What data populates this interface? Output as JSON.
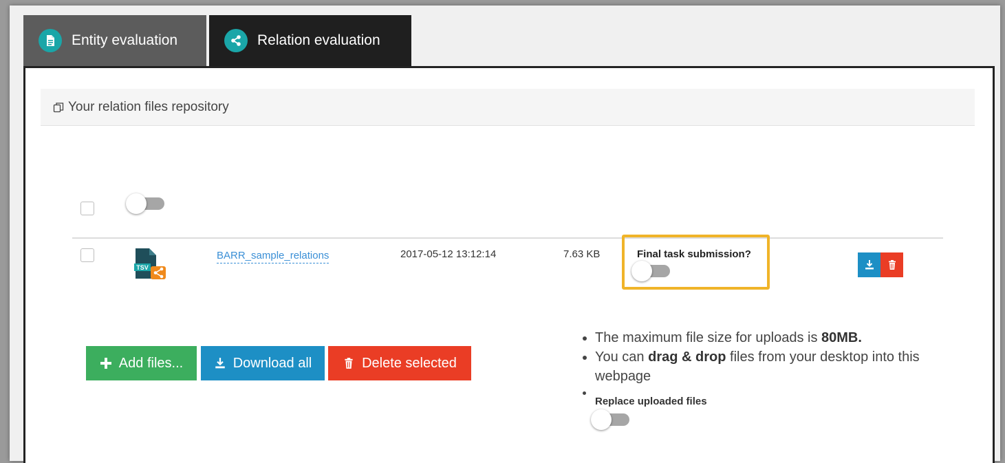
{
  "tabs": {
    "entity": {
      "label": "Entity evaluation",
      "icon": "document-icon"
    },
    "relation": {
      "label": "Relation evaluation",
      "icon": "share-icon",
      "active": true
    }
  },
  "repository": {
    "title": "Your relation files repository",
    "icon": "copy-icon"
  },
  "file_row": {
    "name": "BARR_sample_relations",
    "date": "2017-05-12 13:12:14",
    "size": "7.63 KB",
    "file_type": "TSV",
    "final_submission_label": "Final task submission?"
  },
  "actions": {
    "add_label": "Add files...",
    "download_all_label": "Download all",
    "delete_selected_label": "Delete selected"
  },
  "info": {
    "max_size_prefix": "The maximum file size for uploads is ",
    "max_size_value": "80MB.",
    "drag_prefix": "You can ",
    "drag_bold": "drag & drop",
    "drag_suffix": " files from your desktop into this webpage",
    "replace_label": "Replace uploaded files"
  },
  "colors": {
    "accent_teal": "#1aa6a8",
    "add_green": "#3cae5e",
    "download_blue": "#1d8fc5",
    "delete_red": "#ea3d25",
    "highlight_yellow": "#f0b429",
    "file_orange": "#f08a1c"
  }
}
